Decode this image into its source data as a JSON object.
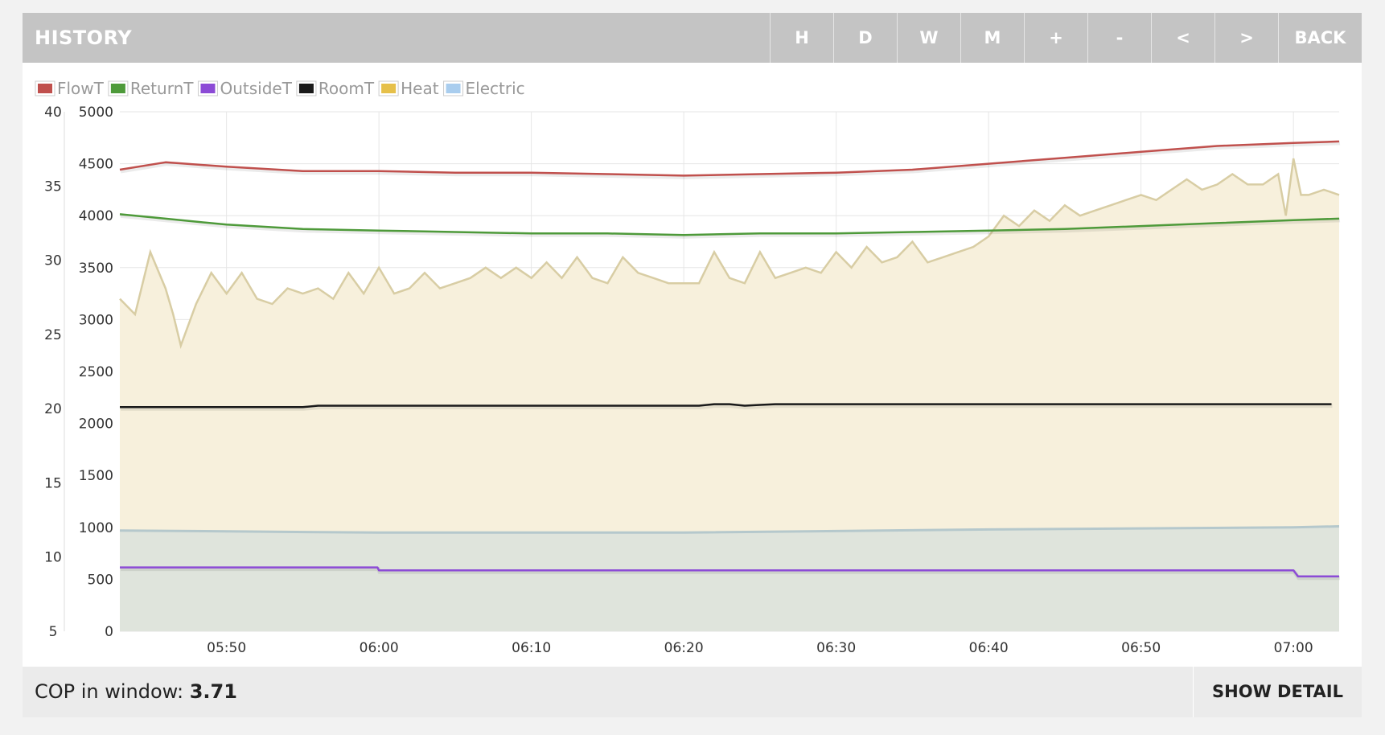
{
  "header": {
    "title": "HISTORY",
    "buttons": [
      "H",
      "D",
      "W",
      "M",
      "+",
      "-",
      "<",
      ">",
      "BACK"
    ]
  },
  "footer": {
    "cop_label": "COP in window:",
    "cop_value": "3.71",
    "show_detail": "SHOW DETAIL"
  },
  "chart_data": {
    "type": "line",
    "xlim": [
      "05:43",
      "07:03"
    ],
    "x_ticks": [
      "05:50",
      "06:00",
      "06:10",
      "06:20",
      "06:30",
      "06:40",
      "06:50",
      "07:00"
    ],
    "y_left": {
      "label": "",
      "ylim": [
        5,
        40
      ],
      "ticks": [
        5,
        10,
        15,
        20,
        25,
        30,
        35,
        40
      ]
    },
    "y_right": {
      "label": "",
      "ylim": [
        0,
        5000
      ],
      "ticks": [
        0,
        500,
        1000,
        1500,
        2000,
        2500,
        3000,
        3500,
        4000,
        4500,
        5000
      ]
    },
    "grid": true,
    "legend_placement": "top-left",
    "series": [
      {
        "name": "FlowT",
        "axis": "left",
        "color": "#c0504d",
        "style": "line",
        "x": [
          "05:43",
          "05:46",
          "05:50",
          "05:55",
          "06:00",
          "06:05",
          "06:10",
          "06:15",
          "06:20",
          "06:25",
          "06:30",
          "06:35",
          "06:40",
          "06:45",
          "06:50",
          "06:55",
          "07:00",
          "07:03"
        ],
        "y": [
          36.1,
          36.6,
          36.3,
          36.0,
          36.0,
          35.9,
          35.9,
          35.8,
          35.7,
          35.8,
          35.9,
          36.1,
          36.5,
          36.9,
          37.3,
          37.7,
          37.9,
          38.0
        ]
      },
      {
        "name": "ReturnT",
        "axis": "left",
        "color": "#4e9a3a",
        "style": "line",
        "x": [
          "05:43",
          "05:46",
          "05:50",
          "05:55",
          "06:00",
          "06:05",
          "06:10",
          "06:15",
          "06:20",
          "06:25",
          "06:30",
          "06:35",
          "06:40",
          "06:45",
          "06:50",
          "06:55",
          "07:00",
          "07:03"
        ],
        "y": [
          33.1,
          32.8,
          32.4,
          32.1,
          32.0,
          31.9,
          31.8,
          31.8,
          31.7,
          31.8,
          31.8,
          31.9,
          32.0,
          32.1,
          32.3,
          32.5,
          32.7,
          32.8
        ]
      },
      {
        "name": "OutsideT",
        "axis": "left",
        "color": "#8c4bd6",
        "style": "line",
        "x": [
          "05:43",
          "05:59.9",
          "06:00",
          "07:00",
          "07:00.3",
          "07:03"
        ],
        "y": [
          9.3,
          9.3,
          9.1,
          9.1,
          8.7,
          8.7
        ]
      },
      {
        "name": "RoomT",
        "axis": "left",
        "color": "#1a1a1a",
        "style": "line",
        "x": [
          "05:43",
          "05:55",
          "05:56",
          "06:21",
          "06:22",
          "06:23",
          "06:24",
          "06:25",
          "06:26",
          "07:02.5"
        ],
        "y": [
          20.1,
          20.1,
          20.2,
          20.2,
          20.3,
          20.3,
          20.2,
          20.25,
          20.3,
          20.3
        ]
      },
      {
        "name": "Heat",
        "axis": "right",
        "color": "#e6c04a",
        "style": "area",
        "x": [
          "05:43",
          "05:44",
          "05:45",
          "05:46",
          "05:46.5",
          "05:47",
          "05:48",
          "05:49",
          "05:50",
          "05:51",
          "05:52",
          "05:53",
          "05:54",
          "05:55",
          "05:56",
          "05:57",
          "05:58",
          "05:59",
          "06:00",
          "06:01",
          "06:02",
          "06:03",
          "06:04",
          "06:05",
          "06:06",
          "06:07",
          "06:08",
          "06:09",
          "06:10",
          "06:11",
          "06:12",
          "06:13",
          "06:14",
          "06:15",
          "06:16",
          "06:17",
          "06:18",
          "06:19",
          "06:20",
          "06:21",
          "06:22",
          "06:23",
          "06:24",
          "06:25",
          "06:26",
          "06:27",
          "06:28",
          "06:29",
          "06:30",
          "06:31",
          "06:32",
          "06:33",
          "06:34",
          "06:35",
          "06:36",
          "06:37",
          "06:38",
          "06:39",
          "06:40",
          "06:41",
          "06:42",
          "06:43",
          "06:44",
          "06:45",
          "06:46",
          "06:47",
          "06:48",
          "06:49",
          "06:50",
          "06:51",
          "06:52",
          "06:53",
          "06:54",
          "06:55",
          "06:56",
          "06:57",
          "06:58",
          "06:59",
          "06:59.5",
          "07:00",
          "07:00.5",
          "07:01",
          "07:02",
          "07:03"
        ],
        "y": [
          3200,
          3050,
          3650,
          3300,
          3050,
          2750,
          3150,
          3450,
          3250,
          3450,
          3200,
          3150,
          3300,
          3250,
          3300,
          3200,
          3450,
          3250,
          3500,
          3250,
          3300,
          3450,
          3300,
          3350,
          3400,
          3500,
          3400,
          3500,
          3400,
          3550,
          3400,
          3600,
          3400,
          3350,
          3600,
          3450,
          3400,
          3350,
          3350,
          3350,
          3650,
          3400,
          3350,
          3650,
          3400,
          3450,
          3500,
          3450,
          3650,
          3500,
          3700,
          3550,
          3600,
          3750,
          3550,
          3600,
          3650,
          3700,
          3800,
          4000,
          3900,
          4050,
          3950,
          4100,
          4000,
          4050,
          4100,
          4150,
          4200,
          4150,
          4250,
          4350,
          4250,
          4300,
          4400,
          4300,
          4300,
          4400,
          4000,
          4550,
          4200,
          4200,
          4250,
          4200
        ]
      },
      {
        "name": "Electric",
        "axis": "right",
        "color": "#a9cdee",
        "style": "area",
        "x": [
          "05:43",
          "06:00",
          "06:20",
          "06:40",
          "07:00",
          "07:03"
        ],
        "y": [
          970,
          950,
          950,
          980,
          1000,
          1010
        ]
      }
    ]
  }
}
